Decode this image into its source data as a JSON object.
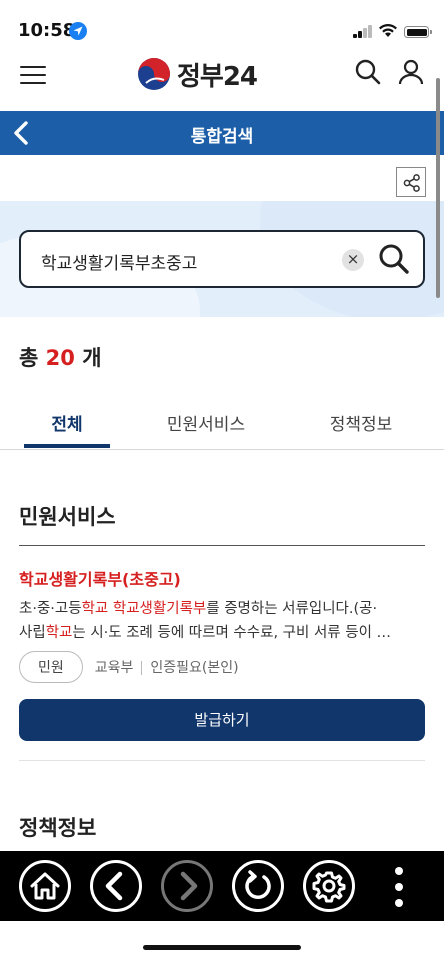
{
  "status_bar": {
    "time": "10:58"
  },
  "header": {
    "logo_text": "정부24"
  },
  "title_bar": {
    "title": "통합검색"
  },
  "search": {
    "query": "학교생활기록부초중고",
    "clear_label": "×"
  },
  "results": {
    "total_prefix": "총",
    "total_count": "20",
    "total_suffix": "개"
  },
  "tabs": [
    {
      "label": "전체",
      "active": true
    },
    {
      "label": "민원서비스",
      "active": false
    },
    {
      "label": "정책정보",
      "active": false
    }
  ],
  "sections": {
    "civil_title": "민원서비스",
    "policy_title": "정책정보"
  },
  "result_item": {
    "title_main": "학교생활기록부",
    "title_paren": "(초중고)",
    "desc_line1_a": "초·중·고등",
    "desc_line1_hl1": "학교",
    "desc_line1_space": " ",
    "desc_line1_hl2": "학교생활기록부",
    "desc_line1_b": "를 증명하는 서류입니다.(공·",
    "desc_line2_a": "사립",
    "desc_line2_hl": "학교",
    "desc_line2_b": "는 시·도 조례 등에 따르며 수수료, 구비 서류 등이 …",
    "tag": "민원",
    "agency": "교육부",
    "auth": "인증필요(본인)",
    "button_label": "발급하기"
  },
  "colors": {
    "primary": "#1c5fa8",
    "navy": "#10366b",
    "highlight": "#d6201f",
    "search_bg": "#e3eefb"
  },
  "icons": {
    "toolbar": [
      "home-icon",
      "back-icon",
      "forward-icon",
      "reload-icon",
      "settings-icon",
      "more-icon"
    ]
  }
}
